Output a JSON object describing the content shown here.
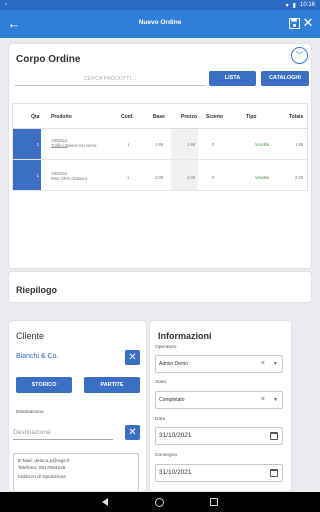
{
  "status": {
    "time": "10:16"
  },
  "appbar": {
    "title": "Nuevo Ordine"
  },
  "ordine": {
    "title": "Corpo Ordine",
    "search_placeholder": "CERCA PRODOTTI...",
    "btn_lista": "LISTA",
    "btn_cataloghi": "CATALOGHI",
    "columns": {
      "qta": "Qta",
      "prodotto": "Prodotto",
      "conf": "Conf.",
      "base": "Base",
      "prezzo": "Prezzo",
      "sconto": "Sconto",
      "tipo": "Tipo",
      "totale": "Totale"
    },
    "rows": [
      {
        "qta": "1",
        "code": "A000114",
        "name": "Truffini Speed con cerna",
        "conf": "1",
        "base": "1.99",
        "prezzo": "1.99",
        "sconto": "0",
        "tipo": "Vendita",
        "totale": "1.99"
      },
      {
        "qta": "1",
        "code": "A000111",
        "name": "Riso ORO Classico",
        "conf": "1",
        "base": "2.00",
        "prezzo": "2.00",
        "sconto": "0",
        "tipo": "Vendita",
        "totale": "2.00"
      }
    ]
  },
  "riepilogo": {
    "title": "Riepilogo"
  },
  "cliente": {
    "title": "Cliente",
    "name": "Bianchi & Co.",
    "btn_storico": "STORICO",
    "btn_partite": "PARTITE",
    "destinazione_label": "Destinazione",
    "destinazione_placeholder": "Destinazione",
    "info_lines": [
      "E-Mail: deluca.p@wgs.it",
      "Telefono: 0817654545",
      "Indirizzo di Spedizione"
    ]
  },
  "informazioni": {
    "title": "Informazioni",
    "operatore_label": "Operatore",
    "operatore_value": "Admin Demo",
    "stato_label": "Stato",
    "stato_value": "Completato",
    "data_label": "Data",
    "data_value": "31/10/2021",
    "consegna_label": "Consegna",
    "consegna_value": "31/10/2021"
  }
}
